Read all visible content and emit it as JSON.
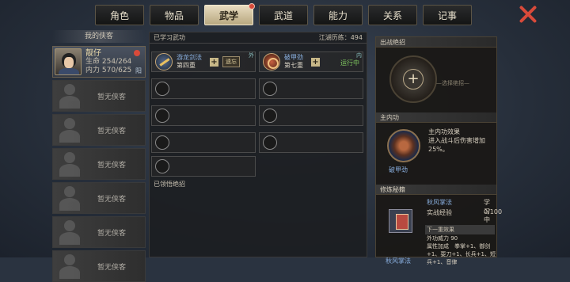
{
  "tabs": [
    {
      "label": "角色"
    },
    {
      "label": "物品"
    },
    {
      "label": "武学"
    },
    {
      "label": "武道"
    },
    {
      "label": "能力"
    },
    {
      "label": "关系"
    },
    {
      "label": "记事"
    }
  ],
  "left": {
    "header": "我的侠客",
    "hero": {
      "name": "靓仔",
      "hp_label": "生命",
      "hp": "254/264",
      "mp_label": "内力",
      "mp": "570/625",
      "tag": "阳"
    },
    "empty_label": "暂无侠客"
  },
  "mid": {
    "learned_title": "已学习武功",
    "exp": "江湖历练：494",
    "skills": [
      {
        "name": "游龙剑法",
        "level": "第四重",
        "button": "遗忘",
        "tag": "外"
      },
      {
        "name": "破甲劲",
        "level": "第七重",
        "status": "运行中",
        "tag": "内"
      }
    ],
    "comprehend_title": "已领悟绝招"
  },
  "right": {
    "ult_title": "出战绝招",
    "ult_select": "—选择绝招—",
    "inner_title": "主内功",
    "inner_effect_title": "主内功效果",
    "inner_effect_text": "进入战斗后伤害增加25%。",
    "inner_name": "破甲劲",
    "manual_title": "修炼秘籍",
    "manual_name": "秋风掌法",
    "manual_status": "学习中",
    "practice_label": "实战经验",
    "practice_value": "0/100",
    "next_label": "下一重效果",
    "next_power": "外功威力 90",
    "next_attr": "属性加成　拳掌+1、御剑+1、耍刀+1、长兵+1、短兵+1、音律",
    "manual_label": "秋风掌法"
  }
}
